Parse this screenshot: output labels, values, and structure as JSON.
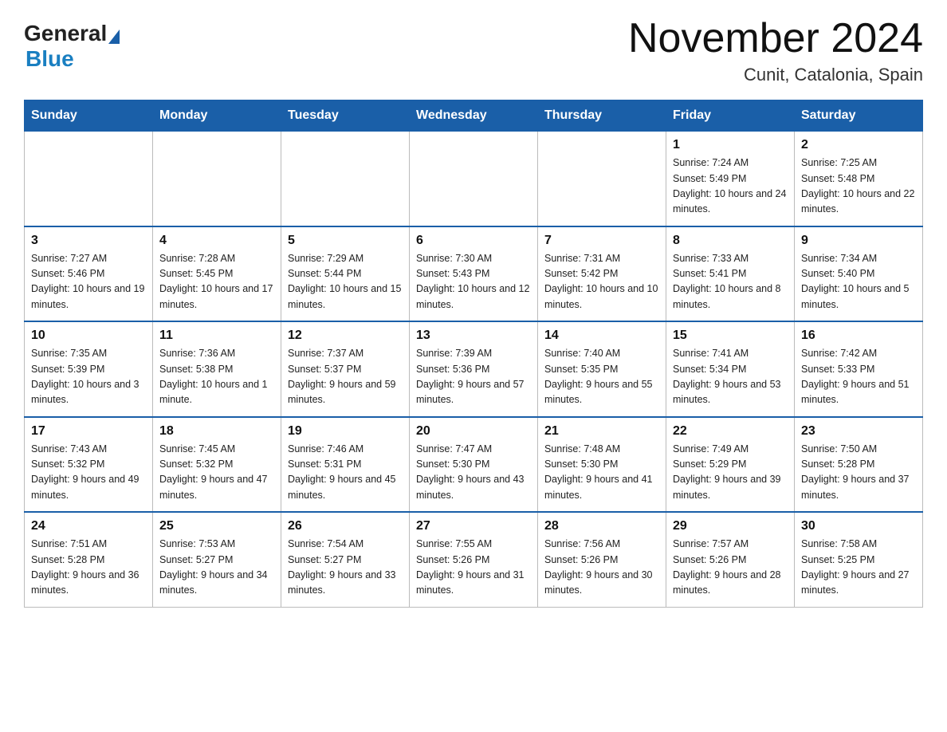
{
  "header": {
    "logo_general": "General",
    "logo_blue": "Blue",
    "month_year": "November 2024",
    "location": "Cunit, Catalonia, Spain"
  },
  "weekdays": [
    "Sunday",
    "Monday",
    "Tuesday",
    "Wednesday",
    "Thursday",
    "Friday",
    "Saturday"
  ],
  "weeks": [
    [
      {
        "day": "",
        "info": ""
      },
      {
        "day": "",
        "info": ""
      },
      {
        "day": "",
        "info": ""
      },
      {
        "day": "",
        "info": ""
      },
      {
        "day": "",
        "info": ""
      },
      {
        "day": "1",
        "info": "Sunrise: 7:24 AM\nSunset: 5:49 PM\nDaylight: 10 hours and 24 minutes."
      },
      {
        "day": "2",
        "info": "Sunrise: 7:25 AM\nSunset: 5:48 PM\nDaylight: 10 hours and 22 minutes."
      }
    ],
    [
      {
        "day": "3",
        "info": "Sunrise: 7:27 AM\nSunset: 5:46 PM\nDaylight: 10 hours and 19 minutes."
      },
      {
        "day": "4",
        "info": "Sunrise: 7:28 AM\nSunset: 5:45 PM\nDaylight: 10 hours and 17 minutes."
      },
      {
        "day": "5",
        "info": "Sunrise: 7:29 AM\nSunset: 5:44 PM\nDaylight: 10 hours and 15 minutes."
      },
      {
        "day": "6",
        "info": "Sunrise: 7:30 AM\nSunset: 5:43 PM\nDaylight: 10 hours and 12 minutes."
      },
      {
        "day": "7",
        "info": "Sunrise: 7:31 AM\nSunset: 5:42 PM\nDaylight: 10 hours and 10 minutes."
      },
      {
        "day": "8",
        "info": "Sunrise: 7:33 AM\nSunset: 5:41 PM\nDaylight: 10 hours and 8 minutes."
      },
      {
        "day": "9",
        "info": "Sunrise: 7:34 AM\nSunset: 5:40 PM\nDaylight: 10 hours and 5 minutes."
      }
    ],
    [
      {
        "day": "10",
        "info": "Sunrise: 7:35 AM\nSunset: 5:39 PM\nDaylight: 10 hours and 3 minutes."
      },
      {
        "day": "11",
        "info": "Sunrise: 7:36 AM\nSunset: 5:38 PM\nDaylight: 10 hours and 1 minute."
      },
      {
        "day": "12",
        "info": "Sunrise: 7:37 AM\nSunset: 5:37 PM\nDaylight: 9 hours and 59 minutes."
      },
      {
        "day": "13",
        "info": "Sunrise: 7:39 AM\nSunset: 5:36 PM\nDaylight: 9 hours and 57 minutes."
      },
      {
        "day": "14",
        "info": "Sunrise: 7:40 AM\nSunset: 5:35 PM\nDaylight: 9 hours and 55 minutes."
      },
      {
        "day": "15",
        "info": "Sunrise: 7:41 AM\nSunset: 5:34 PM\nDaylight: 9 hours and 53 minutes."
      },
      {
        "day": "16",
        "info": "Sunrise: 7:42 AM\nSunset: 5:33 PM\nDaylight: 9 hours and 51 minutes."
      }
    ],
    [
      {
        "day": "17",
        "info": "Sunrise: 7:43 AM\nSunset: 5:32 PM\nDaylight: 9 hours and 49 minutes."
      },
      {
        "day": "18",
        "info": "Sunrise: 7:45 AM\nSunset: 5:32 PM\nDaylight: 9 hours and 47 minutes."
      },
      {
        "day": "19",
        "info": "Sunrise: 7:46 AM\nSunset: 5:31 PM\nDaylight: 9 hours and 45 minutes."
      },
      {
        "day": "20",
        "info": "Sunrise: 7:47 AM\nSunset: 5:30 PM\nDaylight: 9 hours and 43 minutes."
      },
      {
        "day": "21",
        "info": "Sunrise: 7:48 AM\nSunset: 5:30 PM\nDaylight: 9 hours and 41 minutes."
      },
      {
        "day": "22",
        "info": "Sunrise: 7:49 AM\nSunset: 5:29 PM\nDaylight: 9 hours and 39 minutes."
      },
      {
        "day": "23",
        "info": "Sunrise: 7:50 AM\nSunset: 5:28 PM\nDaylight: 9 hours and 37 minutes."
      }
    ],
    [
      {
        "day": "24",
        "info": "Sunrise: 7:51 AM\nSunset: 5:28 PM\nDaylight: 9 hours and 36 minutes."
      },
      {
        "day": "25",
        "info": "Sunrise: 7:53 AM\nSunset: 5:27 PM\nDaylight: 9 hours and 34 minutes."
      },
      {
        "day": "26",
        "info": "Sunrise: 7:54 AM\nSunset: 5:27 PM\nDaylight: 9 hours and 33 minutes."
      },
      {
        "day": "27",
        "info": "Sunrise: 7:55 AM\nSunset: 5:26 PM\nDaylight: 9 hours and 31 minutes."
      },
      {
        "day": "28",
        "info": "Sunrise: 7:56 AM\nSunset: 5:26 PM\nDaylight: 9 hours and 30 minutes."
      },
      {
        "day": "29",
        "info": "Sunrise: 7:57 AM\nSunset: 5:26 PM\nDaylight: 9 hours and 28 minutes."
      },
      {
        "day": "30",
        "info": "Sunrise: 7:58 AM\nSunset: 5:25 PM\nDaylight: 9 hours and 27 minutes."
      }
    ]
  ]
}
